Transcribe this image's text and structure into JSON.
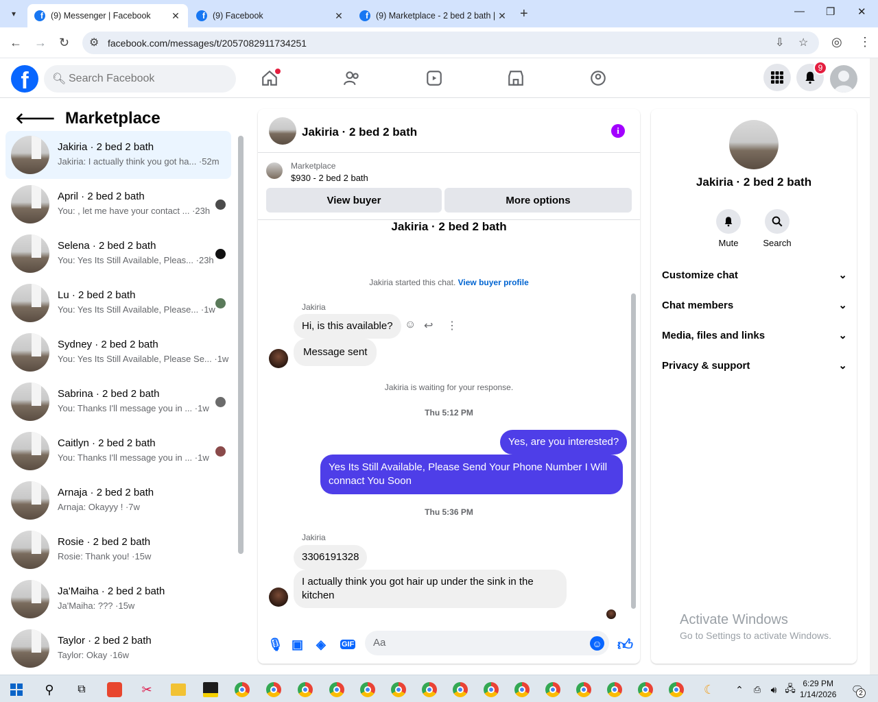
{
  "browser": {
    "tabs": [
      {
        "title": "(9) Messenger | Facebook",
        "active": true
      },
      {
        "title": "(9) Facebook",
        "active": false
      },
      {
        "title": "(9) Marketplace - 2 bed 2 bath |",
        "active": false
      }
    ],
    "url": "facebook.com/messages/t/2057082911734251"
  },
  "fb": {
    "search_placeholder": "Search Facebook",
    "notification_count": "9"
  },
  "sidebar": {
    "title": "Marketplace",
    "conversations": [
      {
        "name": "Jakiria · 2 bed 2 bath",
        "preview": "Jakiria: I actually think you got ha... ·52m",
        "selected": true
      },
      {
        "name": "April · 2 bed 2 bath",
        "preview": "You: , let me have your contact ... ·23h"
      },
      {
        "name": "Selena · 2 bed 2 bath",
        "preview": "You: Yes Its Still Available, Pleas... ·23h"
      },
      {
        "name": "Lu · 2 bed 2 bath",
        "preview": "You: Yes Its Still Available, Please... ·1w"
      },
      {
        "name": "Sydney · 2 bed 2 bath",
        "preview": "You: Yes Its Still Available, Please Se... ·1w"
      },
      {
        "name": "Sabrina · 2 bed 2 bath",
        "preview": "You: Thanks I'll message you in ... ·1w"
      },
      {
        "name": "Caitlyn · 2 bed 2 bath",
        "preview": "You: Thanks I'll message you in ... ·1w"
      },
      {
        "name": "Arnaja · 2 bed 2 bath",
        "preview": "Arnaja: Okayyy ! ·7w"
      },
      {
        "name": "Rosie · 2 bed 2 bath",
        "preview": "Rosie: Thank you! ·15w"
      },
      {
        "name": "Ja'Maiha · 2 bed 2 bath",
        "preview": "Ja'Maiha: ??? ·15w"
      },
      {
        "name": "Taylor · 2 bed 2 bath",
        "preview": "Taylor: Okay ·16w"
      }
    ]
  },
  "chat": {
    "title": "Jakiria · 2 bed 2 bath",
    "marketplace_label": "Marketplace",
    "listing": "$930 - 2 bed 2 bath",
    "view_buyer": "View buyer",
    "more_options": "More options",
    "top_name": "Jakiria · 2 bed 2 bath",
    "started_text": "Jakiria started this chat.",
    "view_buyer_profile": "View buyer profile",
    "sender": "Jakiria",
    "msg1": "Hi, is this available?",
    "msg2": "Message sent",
    "waiting": "Jakiria is waiting for your response.",
    "time1": "Thu 5:12 PM",
    "out1": "Yes, are you interested?",
    "out2": "Yes Its Still Available, Please Send Your Phone Number I Will connact You Soon",
    "time2": "Thu 5:36 PM",
    "sender2": "Jakiria",
    "msg3": "3306191328",
    "msg4": "I actually think you got hair up under the sink in the kitchen",
    "composer_placeholder": "Aa"
  },
  "details": {
    "name": "Jakiria · 2 bed 2 bath",
    "mute": "Mute",
    "search": "Search",
    "rows": [
      "Customize chat",
      "Chat members",
      "Media, files and links",
      "Privacy & support"
    ]
  },
  "watermark": {
    "line1": "Activate Windows",
    "line2": "Go to Settings to activate Windows."
  },
  "taskbar": {
    "time": "6:29 PM",
    "date": "1/14/2026",
    "notif": "2"
  }
}
